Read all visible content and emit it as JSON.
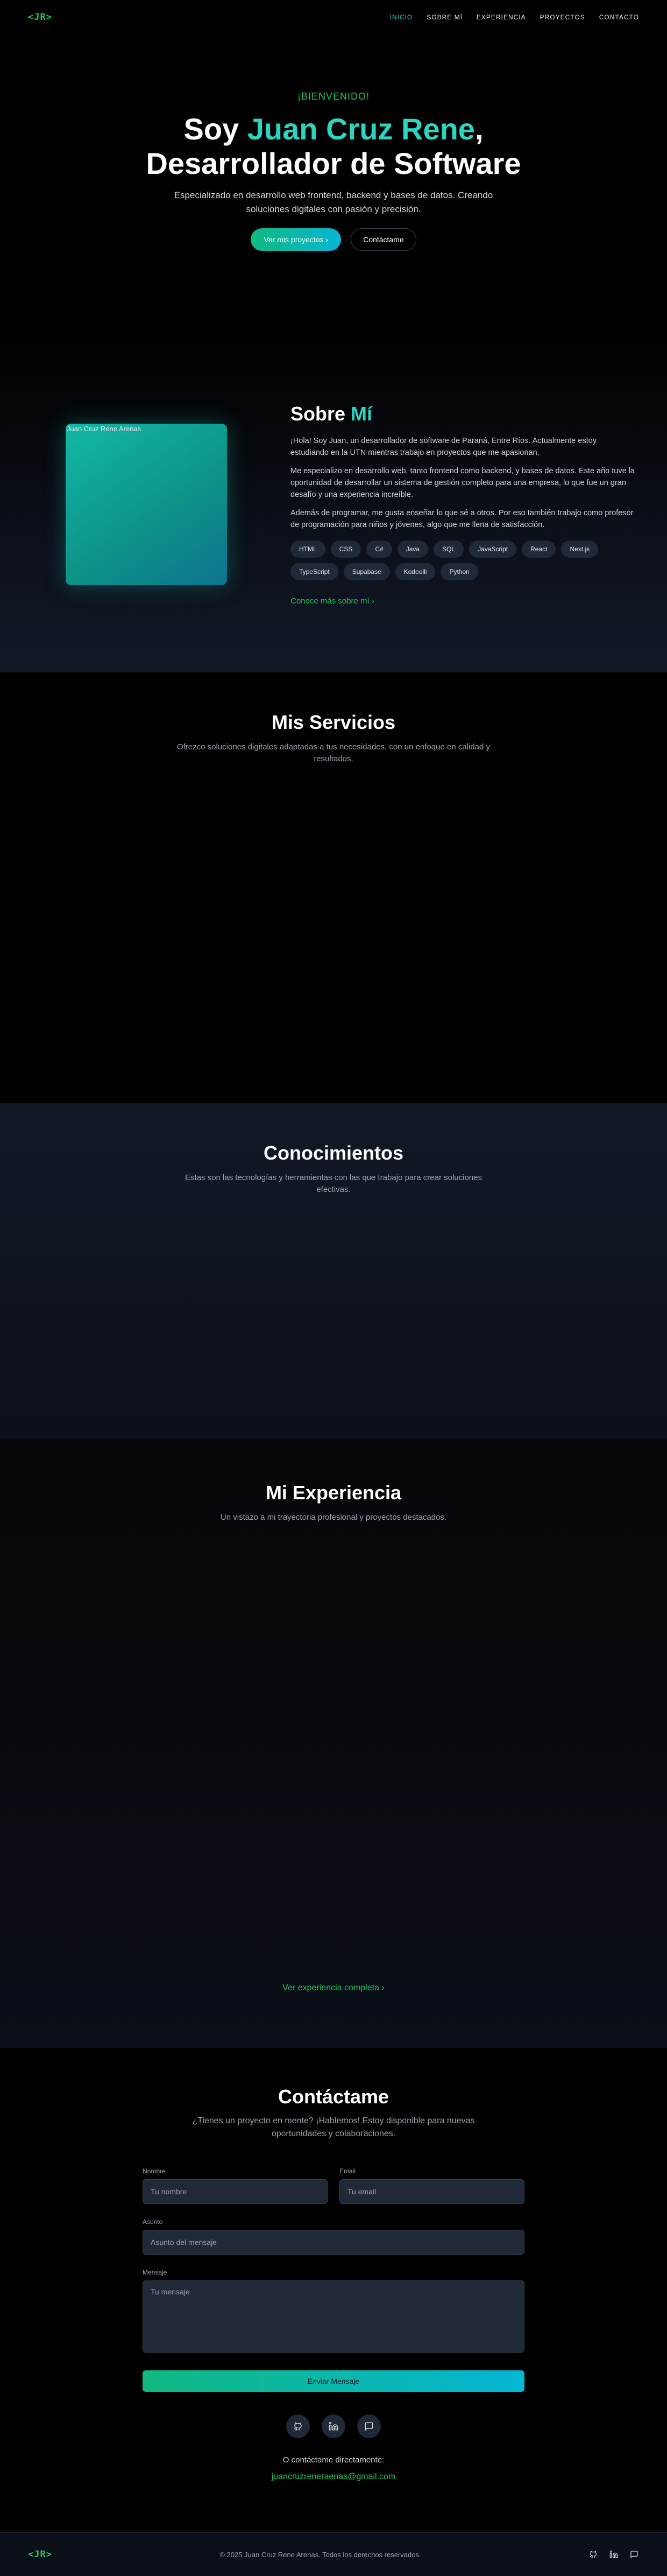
{
  "header": {
    "logo": "<JR>",
    "nav": [
      "INICIO",
      "SOBRE MÍ",
      "EXPERIENCIA",
      "PROYECTOS",
      "CONTACTO"
    ]
  },
  "hero": {
    "welcome": "¡BIENVENIDO!",
    "title_prefix": "Soy ",
    "title_name": "Juan Cruz Rene",
    "title_comma": ",",
    "title_line2": "Desarrollador de Software",
    "subtitle": "Especializado en desarrollo web frontend, backend y bases de datos. Creando soluciones digitales con pasión y precisión.",
    "primary_button": "Ver mis proyectos ›",
    "secondary_button": "Contáctame"
  },
  "about": {
    "image_alt": "Juan Cruz Rene Arenas",
    "title_prefix": "Sobre ",
    "title_accent": "Mí",
    "paragraphs": [
      "¡Hola! Soy Juan, un desarrollador de software de Paraná, Entre Ríos. Actualmente estoy estudiando en la UTN mientras trabajo en proyectos que me apasionan.",
      "Me especializo en desarrollo web, tanto frontend como backend, y bases de datos. Este año tuve la oportunidad de desarrollar un sistema de gestión completo para una empresa, lo que fue un gran desafío y una experiencia increíble.",
      "Además de programar, me gusta enseñar lo que sé a otros. Por eso también trabajo como profesor de programación para niños y jóvenes, algo que me llena de satisfacción."
    ],
    "skills": [
      "HTML",
      "CSS",
      "C#",
      "Java",
      "SQL",
      "JavaScript",
      "React",
      "Next.js",
      "TypeScript",
      "Supabase",
      "Kodeulli",
      "Python"
    ],
    "link": "Conoce más sobre mí ›"
  },
  "services": {
    "title": "Mis Servicios",
    "subtitle": "Ofrezco soluciones digitales adaptadas a tus necesidades, con un enfoque en calidad y resultados."
  },
  "knowledge": {
    "title": "Conocimientos",
    "subtitle": "Estas son las tecnologías y herramientas con las que trabajo para crear soluciones efectivas."
  },
  "experience": {
    "title": "Mi Experiencia",
    "subtitle": "Un vistazo a mi trayectoria profesional y proyectos destacados.",
    "link": "Ver experiencia completa ›"
  },
  "contact": {
    "title": "Contáctame",
    "subtitle": "¿Tienes un proyecto en mente? ¡Hablemos! Estoy disponible para nuevas oportunidades y colaboraciones.",
    "name_label": "Nombre",
    "name_placeholder": "Tu nombre",
    "email_label": "Email",
    "email_placeholder": "Tu email",
    "subject_label": "Asunto",
    "subject_placeholder": "Asunto del mensaje",
    "message_label": "Mensaje",
    "message_placeholder": "Tu mensaje",
    "submit": "Enviar Mensaje",
    "alt_text": "O contáctame directamente:",
    "email": "juancruzreneraenas@gmail.com"
  },
  "footer": {
    "logo": "<JR>",
    "copyright": "© 2025 Juan Cruz Rene Arenas. Todos los derechos reservados."
  },
  "colors": {
    "accent": "#2dd4bf",
    "green": "#22c55e",
    "bg": "#000000"
  }
}
